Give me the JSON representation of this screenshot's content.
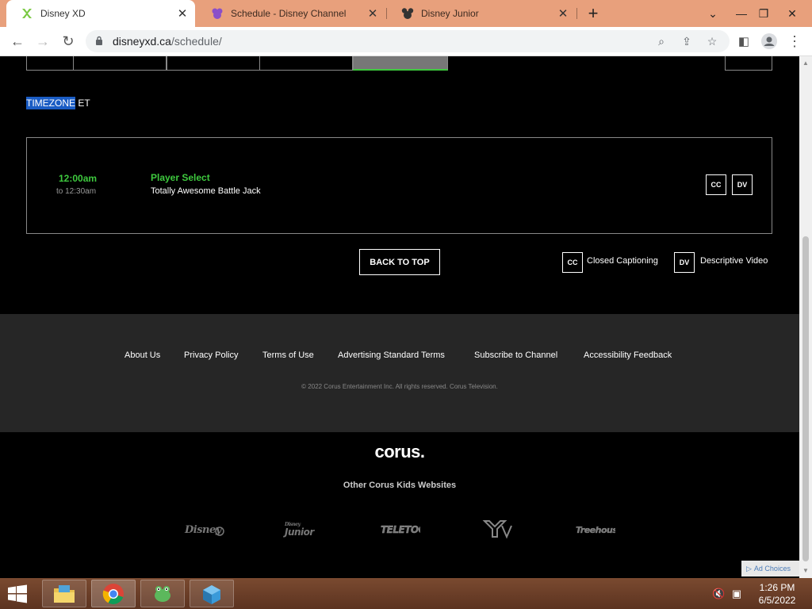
{
  "browser": {
    "tabs": [
      {
        "title": "Disney XD",
        "active": true
      },
      {
        "title": "Schedule - Disney Channel",
        "active": false
      },
      {
        "title": "Disney Junior",
        "active": false
      }
    ],
    "url_host": "disneyxd.ca",
    "url_path": "/schedule/"
  },
  "schedule": {
    "timezone_label": "TIMEZONE",
    "timezone_value": "ET",
    "show": {
      "start": "12:00am",
      "end": "to 12:30am",
      "title": "Player Select",
      "episode": "Totally Awesome Battle Jack",
      "badges": [
        "CC",
        "DV"
      ]
    },
    "back_to_top": "BACK TO TOP",
    "legend": [
      {
        "badge": "CC",
        "label": "Closed Captioning"
      },
      {
        "badge": "DV",
        "label": "Descriptive Video"
      }
    ]
  },
  "footer": {
    "links": [
      "About Us",
      "Privacy Policy",
      "Terms of Use",
      "Advertising Standard Terms",
      "Subscribe to Channel",
      "Accessibility Feedback"
    ],
    "copyright": "© 2022 Corus Entertainment Inc. All rights reserved. Corus Television.",
    "corus_logo": "corus.",
    "other_sites": "Other Corus Kids Websites",
    "brands": [
      "Disney Channel",
      "Disney Junior",
      "Teletoon",
      "YTV",
      "Treehouse"
    ]
  },
  "ad_choices": "Ad Choices",
  "taskbar": {
    "time": "1:26 PM",
    "date": "6/5/2022"
  },
  "colors": {
    "accent_green": "#3ec93e",
    "tab_strip": "#e8a07c",
    "selection": "#1a5cc4"
  }
}
